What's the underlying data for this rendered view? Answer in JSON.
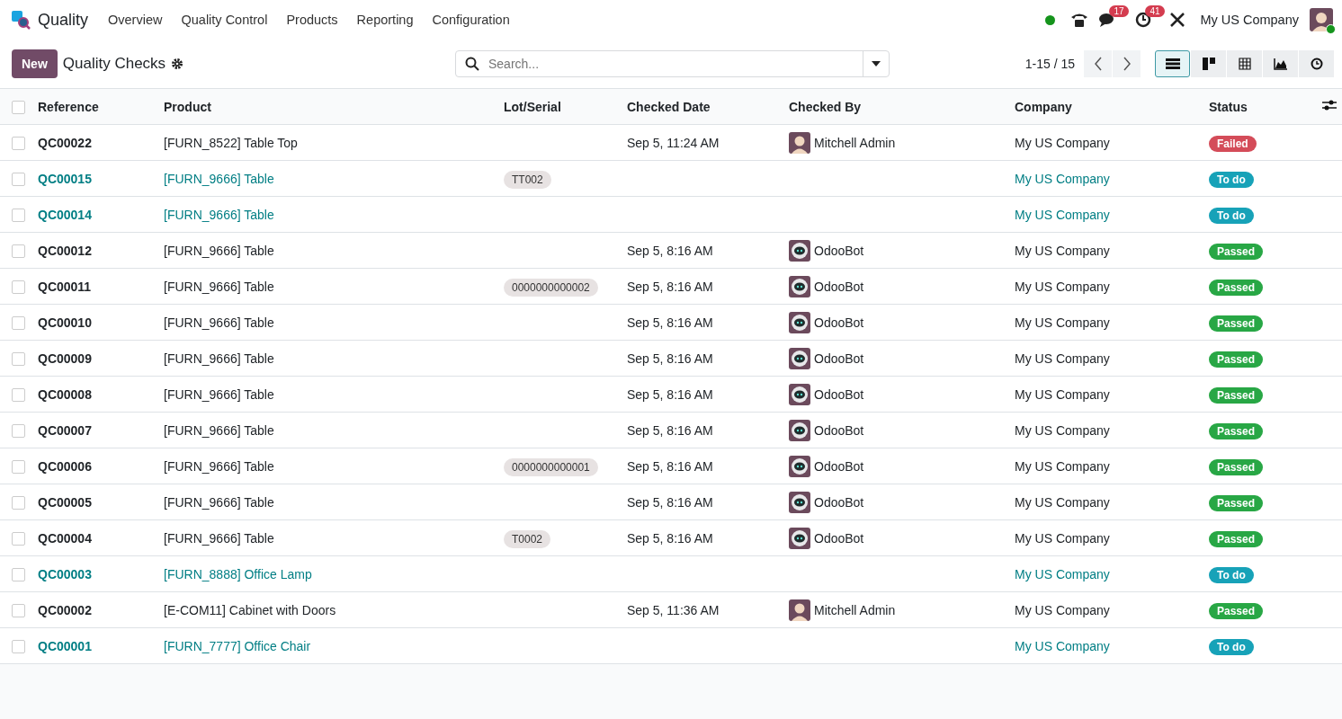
{
  "app": {
    "name": "Quality"
  },
  "menu": [
    "Overview",
    "Quality Control",
    "Products",
    "Reporting",
    "Configuration"
  ],
  "systray": {
    "messages_count": "17",
    "activities_count": "41",
    "company": "My US Company"
  },
  "control_panel": {
    "new_button": "New",
    "title": "Quality Checks",
    "search": {
      "placeholder": "Search..."
    },
    "pager": "1-15 / 15",
    "views": [
      {
        "kind": "list",
        "selected": true
      },
      {
        "kind": "kanban",
        "selected": false
      },
      {
        "kind": "pivot",
        "selected": false
      },
      {
        "kind": "graph",
        "selected": false
      },
      {
        "kind": "activity",
        "selected": false
      }
    ]
  },
  "table": {
    "all_checked": false,
    "columns": [
      "Reference",
      "Product",
      "Lot/Serial",
      "Checked Date",
      "Checked By",
      "Company",
      "Status"
    ],
    "rows": [
      {
        "checked": false,
        "reference": "QC00022",
        "product": "[FURN_8522] Table Top",
        "lot": "",
        "date": "Sep 5, 11:24 AM",
        "checker": {
          "name": "Mitchell Admin",
          "kind": "admin"
        },
        "company": "My US Company",
        "status": {
          "label": "Failed",
          "kind": "failed"
        }
      },
      {
        "checked": false,
        "reference": "QC00015",
        "product": "[FURN_9666] Table",
        "lot": "TT002",
        "date": "",
        "checker": null,
        "company": "My US Company",
        "status": {
          "label": "To do",
          "kind": "todo"
        }
      },
      {
        "checked": false,
        "reference": "QC00014",
        "product": "[FURN_9666] Table",
        "lot": "",
        "date": "",
        "checker": null,
        "company": "My US Company",
        "status": {
          "label": "To do",
          "kind": "todo"
        }
      },
      {
        "checked": false,
        "reference": "QC00012",
        "product": "[FURN_9666] Table",
        "lot": "",
        "date": "Sep 5, 8:16 AM",
        "checker": {
          "name": "OdooBot",
          "kind": "bot"
        },
        "company": "My US Company",
        "status": {
          "label": "Passed",
          "kind": "passed"
        }
      },
      {
        "checked": false,
        "reference": "QC00011",
        "product": "[FURN_9666] Table",
        "lot": "0000000000002",
        "date": "Sep 5, 8:16 AM",
        "checker": {
          "name": "OdooBot",
          "kind": "bot"
        },
        "company": "My US Company",
        "status": {
          "label": "Passed",
          "kind": "passed"
        }
      },
      {
        "checked": false,
        "reference": "QC00010",
        "product": "[FURN_9666] Table",
        "lot": "",
        "date": "Sep 5, 8:16 AM",
        "checker": {
          "name": "OdooBot",
          "kind": "bot"
        },
        "company": "My US Company",
        "status": {
          "label": "Passed",
          "kind": "passed"
        }
      },
      {
        "checked": false,
        "reference": "QC00009",
        "product": "[FURN_9666] Table",
        "lot": "",
        "date": "Sep 5, 8:16 AM",
        "checker": {
          "name": "OdooBot",
          "kind": "bot"
        },
        "company": "My US Company",
        "status": {
          "label": "Passed",
          "kind": "passed"
        }
      },
      {
        "checked": false,
        "reference": "QC00008",
        "product": "[FURN_9666] Table",
        "lot": "",
        "date": "Sep 5, 8:16 AM",
        "checker": {
          "name": "OdooBot",
          "kind": "bot"
        },
        "company": "My US Company",
        "status": {
          "label": "Passed",
          "kind": "passed"
        }
      },
      {
        "checked": false,
        "reference": "QC00007",
        "product": "[FURN_9666] Table",
        "lot": "",
        "date": "Sep 5, 8:16 AM",
        "checker": {
          "name": "OdooBot",
          "kind": "bot"
        },
        "company": "My US Company",
        "status": {
          "label": "Passed",
          "kind": "passed"
        }
      },
      {
        "checked": false,
        "reference": "QC00006",
        "product": "[FURN_9666] Table",
        "lot": "0000000000001",
        "date": "Sep 5, 8:16 AM",
        "checker": {
          "name": "OdooBot",
          "kind": "bot"
        },
        "company": "My US Company",
        "status": {
          "label": "Passed",
          "kind": "passed"
        }
      },
      {
        "checked": false,
        "reference": "QC00005",
        "product": "[FURN_9666] Table",
        "lot": "",
        "date": "Sep 5, 8:16 AM",
        "checker": {
          "name": "OdooBot",
          "kind": "bot"
        },
        "company": "My US Company",
        "status": {
          "label": "Passed",
          "kind": "passed"
        }
      },
      {
        "checked": false,
        "reference": "QC00004",
        "product": "[FURN_9666] Table",
        "lot": "T0002",
        "date": "Sep 5, 8:16 AM",
        "checker": {
          "name": "OdooBot",
          "kind": "bot"
        },
        "company": "My US Company",
        "status": {
          "label": "Passed",
          "kind": "passed"
        }
      },
      {
        "checked": false,
        "reference": "QC00003",
        "product": "[FURN_8888] Office Lamp",
        "lot": "",
        "date": "",
        "checker": null,
        "company": "My US Company",
        "status": {
          "label": "To do",
          "kind": "todo"
        }
      },
      {
        "checked": false,
        "reference": "QC00002",
        "product": "[E-COM11] Cabinet with Doors",
        "lot": "",
        "date": "Sep 5, 11:36 AM",
        "checker": {
          "name": "Mitchell Admin",
          "kind": "admin"
        },
        "company": "My US Company",
        "status": {
          "label": "Passed",
          "kind": "passed"
        }
      },
      {
        "checked": false,
        "reference": "QC00001",
        "product": "[FURN_7777] Office Chair",
        "lot": "",
        "date": "",
        "checker": null,
        "company": "My US Company",
        "status": {
          "label": "To do",
          "kind": "todo"
        }
      }
    ]
  }
}
